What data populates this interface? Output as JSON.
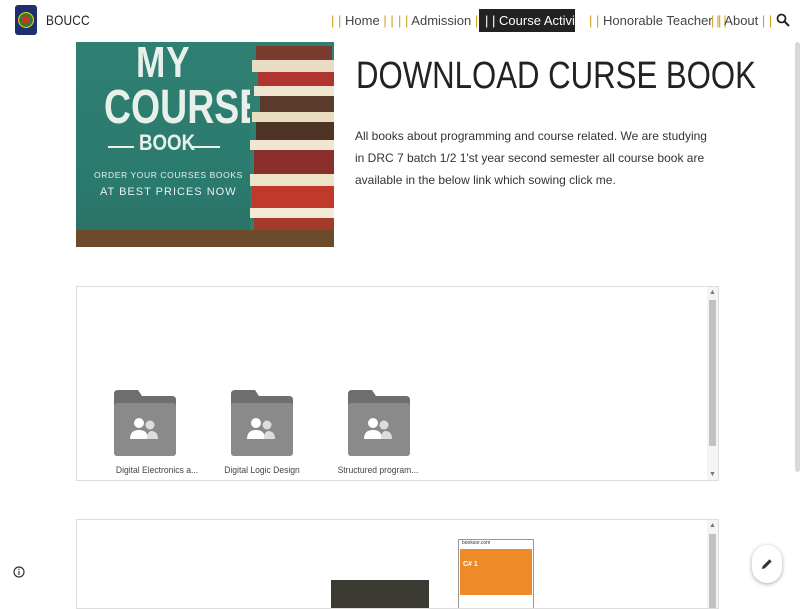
{
  "header": {
    "site_title": "BOUCC",
    "nav": [
      {
        "label": "| | Home | |"
      },
      {
        "label": "| | Admission | |"
      },
      {
        "label": "| | Course Activity | |"
      },
      {
        "label": "| | Honorable Teacher | |"
      },
      {
        "label": "| | About | |"
      }
    ],
    "active_nav": "| | Course Activity | |"
  },
  "hero": {
    "image": {
      "line1": "MY",
      "line2": "COURSE",
      "line3": "BOOK",
      "line4": "ORDER YOUR COURSES BOOKS",
      "line5": "AT BEST PRICES NOW"
    },
    "heading": "DOWNLOAD CURSE BOOK",
    "description": "All books about programming and course related. We are studying in DRC 7 batch 1/2 1'st year second semester all course book are available in the below link which sowing click me."
  },
  "drive_folders": [
    {
      "label": "Digital Electronics a...",
      "icon": "shared-folder-icon"
    },
    {
      "label": "Digital Logic Design",
      "icon": "shared-folder-icon"
    },
    {
      "label": "Structured program...",
      "icon": "shared-folder-icon"
    }
  ],
  "second_embed": {
    "card_label": "booksor.com",
    "card_heading": "C# 1"
  },
  "colors": {
    "nav_active_bg": "#222222",
    "nav_pipe": "#d4a017",
    "chalkboard": "#2f7f73",
    "folder": "#8a8a8a",
    "folder_tab": "#6e6e6e",
    "orange_card": "#ef8a2a"
  }
}
